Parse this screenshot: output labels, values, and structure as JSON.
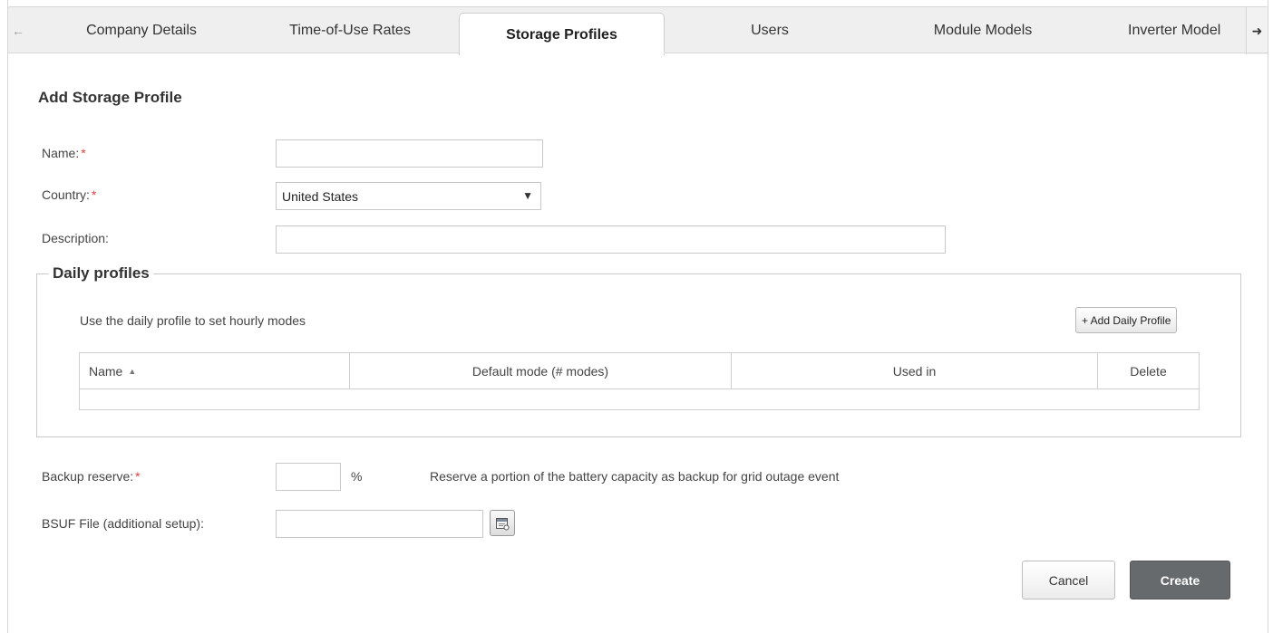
{
  "tabs": [
    {
      "label": "Company Details",
      "active": false
    },
    {
      "label": "Time-of-Use Rates",
      "active": false
    },
    {
      "label": "Storage Profiles",
      "active": true
    },
    {
      "label": "Users",
      "active": false
    },
    {
      "label": "Module Models",
      "active": false
    },
    {
      "label": "Inverter Model",
      "active": false
    }
  ],
  "tab_nav": {
    "prev_icon": "arrow-left-icon",
    "next_icon": "arrow-right-icon"
  },
  "form": {
    "title": "Add Storage Profile",
    "required_marker": "*",
    "name": {
      "label": "Name:",
      "value": "",
      "placeholder": ""
    },
    "country": {
      "label": "Country:",
      "selected": "United States"
    },
    "description": {
      "label": "Description:",
      "value": "",
      "placeholder": ""
    }
  },
  "daily_profiles": {
    "legend": "Daily profiles",
    "hint": "Use the daily profile to set hourly modes",
    "add_button": "+ Add Daily Profile",
    "columns": [
      "Name",
      "Default mode (# modes)",
      "Used in",
      "Delete"
    ],
    "sort_column": "Name",
    "sort_direction": "ascending",
    "rows": []
  },
  "backup_reserve": {
    "label": "Backup reserve:",
    "value": "",
    "unit": "%",
    "help": "Reserve a portion of the battery capacity as backup for grid outage event"
  },
  "bsuf": {
    "label": "BSUF File (additional setup):",
    "value": "",
    "browse_icon": "file-browse-icon"
  },
  "actions": {
    "cancel": "Cancel",
    "create": "Create"
  },
  "colors": {
    "required": "#e04040",
    "create_button": "#666a6d",
    "tab_bar": "#efefef"
  }
}
